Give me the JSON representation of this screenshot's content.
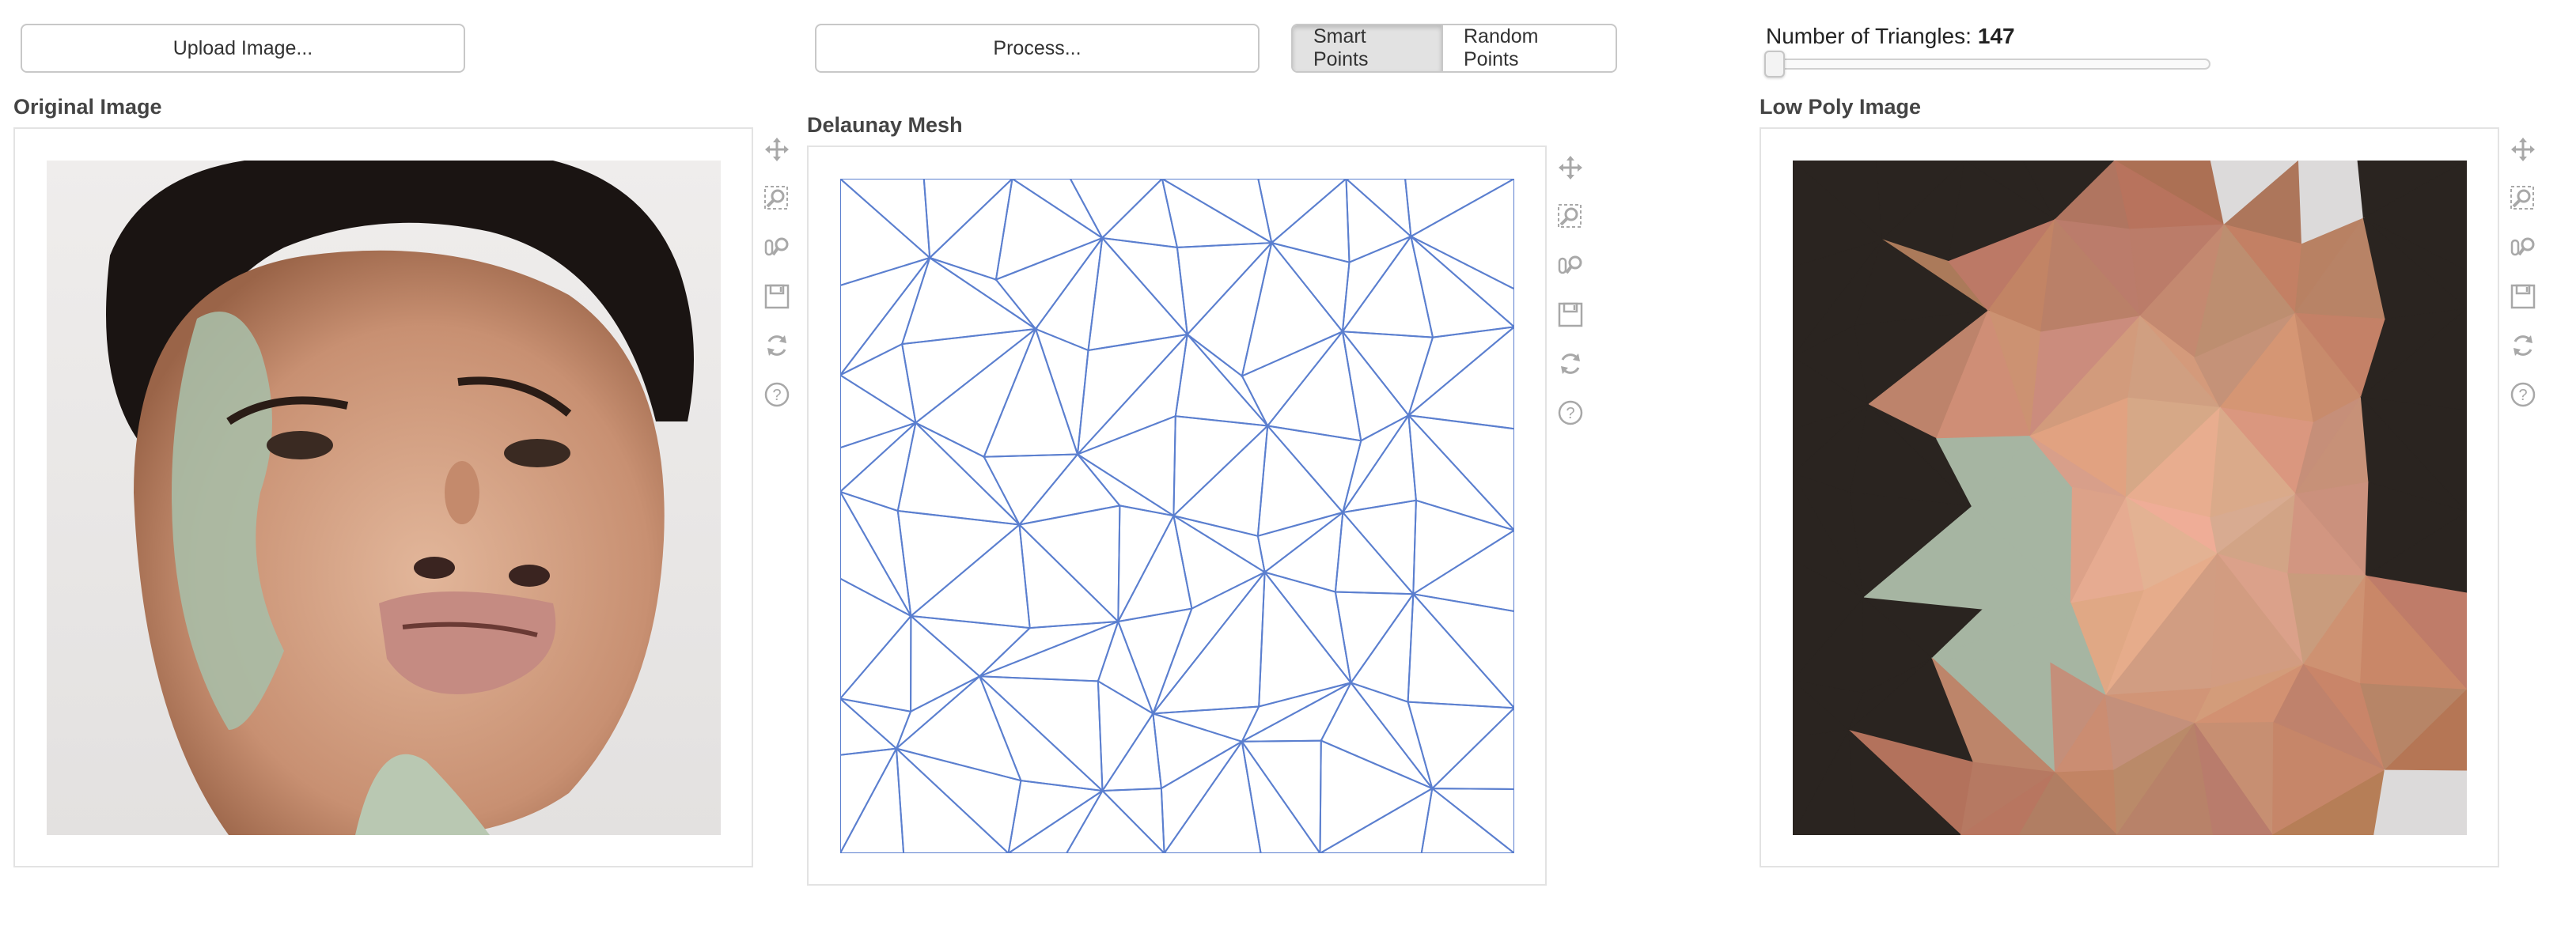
{
  "controls": {
    "upload_label": "Upload Image...",
    "process_label": "Process...",
    "point_modes": [
      "Smart Points",
      "Random Points"
    ],
    "active_point_mode": "Smart Points",
    "triangles_label": "Number of Triangles:",
    "triangles_value": "147"
  },
  "panels": {
    "original_title": "Original Image",
    "mesh_title": "Delaunay Mesh",
    "lowpoly_title": "Low Poly Image"
  },
  "toolbar_icons": [
    "pan-icon",
    "box-zoom-icon",
    "wheel-zoom-icon",
    "save-icon",
    "reset-icon",
    "help-icon"
  ],
  "colors": {
    "mesh_line": "#5b7fcf",
    "border": "#e3e3e3",
    "active_toggle": "#e2e2e2"
  }
}
